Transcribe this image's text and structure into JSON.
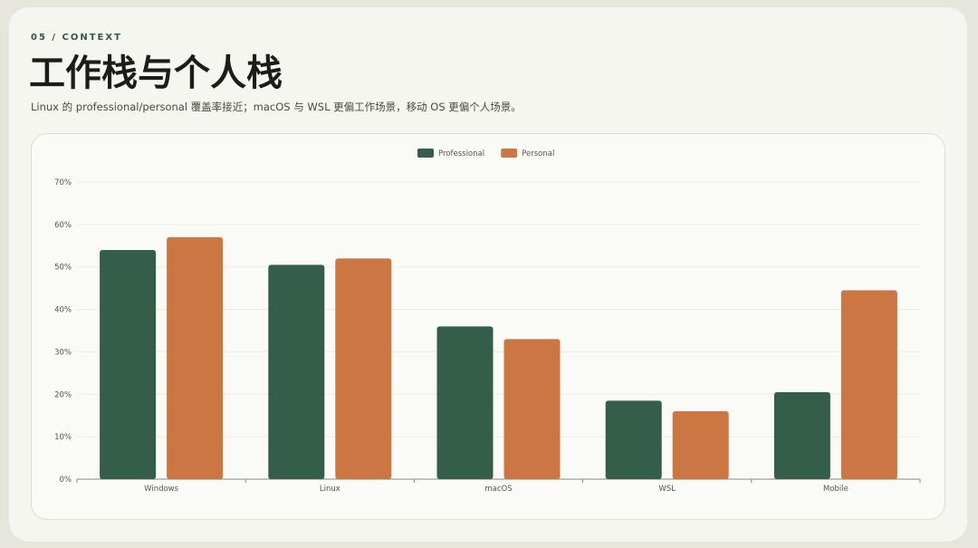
{
  "eyebrow": "05 / CONTEXT",
  "title": "工作栈与个人栈",
  "subtitle": "Linux 的 professional/personal 覆盖率接近；macOS 与 WSL 更偏工作场景，移动 OS 更偏个人场景。",
  "colors": {
    "professional": "#355e4a",
    "personal": "#cc7644",
    "grid": "#ececdf",
    "axis": "#8a8a80",
    "text": "#555550"
  },
  "chart_data": {
    "type": "bar",
    "categories": [
      "Windows",
      "Linux",
      "macOS",
      "WSL",
      "Mobile"
    ],
    "series": [
      {
        "name": "Professional",
        "values": [
          54,
          50.5,
          36,
          18.5,
          20.5
        ]
      },
      {
        "name": "Personal",
        "values": [
          57,
          52,
          33,
          16,
          44.5
        ]
      }
    ],
    "yticks": [
      "0%",
      "10%",
      "20%",
      "30%",
      "40%",
      "50%",
      "60%",
      "70%"
    ],
    "ylim": [
      0,
      70
    ],
    "grid": true,
    "legend": "top-center"
  }
}
